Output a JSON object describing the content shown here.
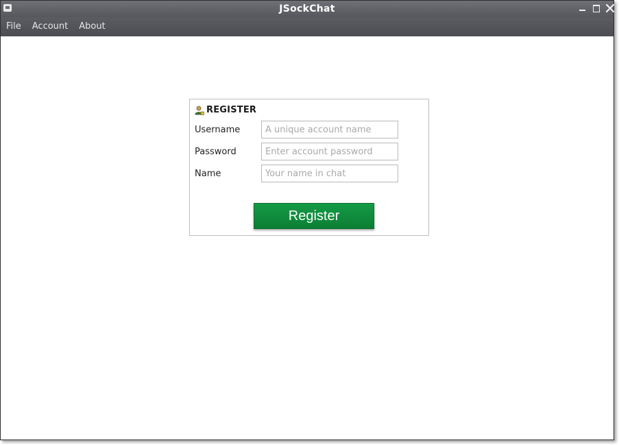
{
  "window": {
    "title": "JSockChat"
  },
  "menu": {
    "items": [
      {
        "label": "File"
      },
      {
        "label": "Account"
      },
      {
        "label": "About"
      }
    ]
  },
  "register": {
    "heading": "REGISTER",
    "icon": "user-icon",
    "fields": [
      {
        "label": "Username",
        "placeholder": "A unique account name",
        "value": ""
      },
      {
        "label": "Password",
        "placeholder": "Enter account password",
        "value": ""
      },
      {
        "label": "Name",
        "placeholder": "Your name in chat",
        "value": ""
      }
    ],
    "button_label": "Register"
  },
  "colors": {
    "titlebar": "#5f6166",
    "menubar": "#505257",
    "button_green": "#118f3f",
    "panel_border": "#bdbdbd"
  }
}
